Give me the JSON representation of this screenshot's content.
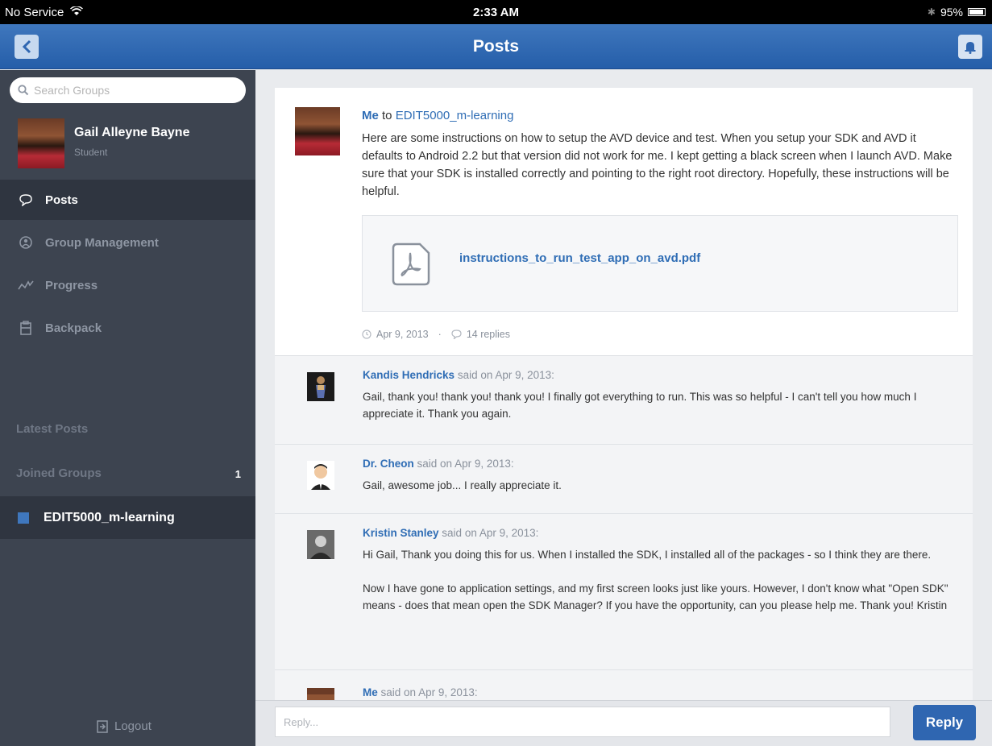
{
  "status_bar": {
    "carrier": "No Service",
    "time": "2:33 AM",
    "battery": "95%"
  },
  "nav": {
    "title": "Posts"
  },
  "sidebar": {
    "search_placeholder": "Search Groups",
    "profile": {
      "name": "Gail Alleyne Bayne",
      "role": "Student"
    },
    "menu": [
      {
        "label": "Posts",
        "icon": "speech-bubble-icon"
      },
      {
        "label": "Group Management",
        "icon": "group-icon"
      },
      {
        "label": "Progress",
        "icon": "progress-chart-icon"
      },
      {
        "label": "Backpack",
        "icon": "backpack-icon"
      }
    ],
    "latest_posts": "Latest Posts",
    "joined_groups": "Joined Groups",
    "joined_count": "1",
    "group": "EDIT5000_m-learning",
    "logout": "Logout"
  },
  "post": {
    "author": "Me",
    "to_word": "to",
    "group": "EDIT5000_m-learning",
    "body": "Here are some instructions on how to setup the AVD device and test.  When you setup your SDK and AVD it defaults to Android 2.2 but that version did not work for me.  I kept getting a black screen when I launch AVD.  Make sure that your SDK is installed correctly and pointing to the right root directory.  Hopefully, these instructions will be helpful.",
    "attachment": "instructions_to_run_test_app_on_avd.pdf",
    "date": "Apr 9, 2013",
    "replies": "14 replies"
  },
  "replies": [
    {
      "name": "Kandis Hendricks",
      "said": "said on",
      "date": "Apr 9, 2013:",
      "body": "Gail, thank you! thank you! thank you! I finally got everything to run. This was so helpful - I can't tell you how much I appreciate it. Thank you again."
    },
    {
      "name": "Dr. Cheon",
      "said": "said on",
      "date": "Apr 9, 2013:",
      "body": "Gail, awesome job...  I really appreciate it."
    },
    {
      "name": "Kristin Stanley",
      "said": "said on",
      "date": "Apr 9, 2013:",
      "body": "Hi Gail, Thank you doing this for us. When I installed the SDK, I installed all of the packages - so I think they are there.",
      "body2": "Now I have gone to application settings, and my first screen looks just like yours. However, I don't know what \"Open SDK\" means - does that mean open the SDK Manager? If you have the opportunity, can you please help me. Thank you! Kristin"
    },
    {
      "name": "Me",
      "said": "said on",
      "date": "Apr 9, 2013:",
      "body": ""
    }
  ],
  "reply_bar": {
    "placeholder": "Reply...",
    "button": "Reply"
  },
  "colors": {
    "accent": "#2f66b1",
    "sidebar": "#3d4450",
    "link": "#2f6db5"
  }
}
